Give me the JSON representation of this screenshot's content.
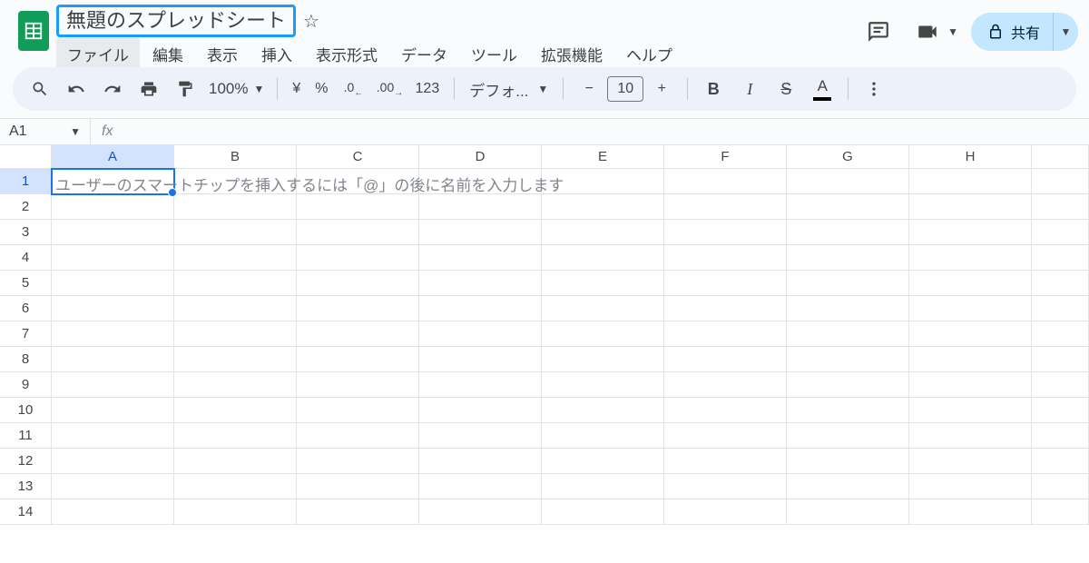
{
  "header": {
    "doc_title": "無題のスプレッドシート",
    "star_tooltip": "スター"
  },
  "menus": [
    "ファイル",
    "編集",
    "表示",
    "挿入",
    "表示形式",
    "データ",
    "ツール",
    "拡張機能",
    "ヘルプ"
  ],
  "share": {
    "label": "共有"
  },
  "toolbar": {
    "zoom": "100%",
    "currency": "¥",
    "percent": "%",
    "dec_dec": ".0",
    "inc_dec": ".00",
    "num_fmt": "123",
    "font_name": "デフォ...",
    "font_size": "10"
  },
  "formula": {
    "name_box": "A1",
    "fx": "fx"
  },
  "grid": {
    "columns": [
      "A",
      "B",
      "C",
      "D",
      "E",
      "F",
      "G",
      "H"
    ],
    "rows": [
      "1",
      "2",
      "3",
      "4",
      "5",
      "6",
      "7",
      "8",
      "9",
      "10",
      "11",
      "12",
      "13",
      "14"
    ],
    "active_cell": {
      "row": 0,
      "col": 0
    },
    "placeholder": "ユーザーのスマートチップを挿入するには「@」の後に名前を入力します"
  }
}
